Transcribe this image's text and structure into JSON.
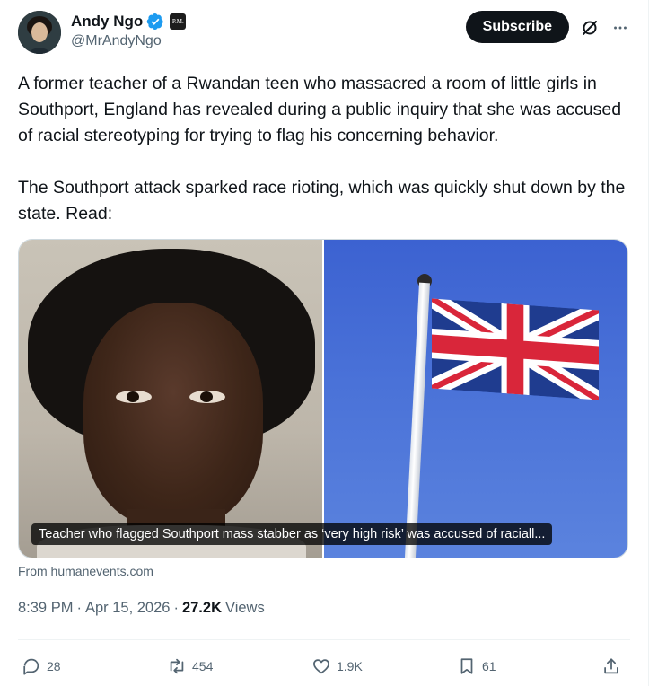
{
  "author": {
    "display_name": "Andy Ngo",
    "handle": "@MrAndyNgo",
    "affiliate_badge_text": "P.M."
  },
  "header": {
    "subscribe_label": "Subscribe"
  },
  "tweet": {
    "text": "A former teacher of a Rwandan teen who massacred a room of little girls in Southport, England has revealed during a public inquiry that she was accused of racial stereotyping for trying to flag his concerning behavior.\n\nThe Southport attack sparked race rioting, which was quickly shut down by the state. Read:",
    "card_caption": "Teacher who flagged Southport mass stabber as ‘very high risk’ was accused of raciall...",
    "card_source": "From humanevents.com"
  },
  "meta": {
    "time": "8:39 PM",
    "dot1": "·",
    "date": "Apr 15, 2026",
    "dot2": "·",
    "views_count": "27.2K",
    "views_label": "Views"
  },
  "actions": {
    "replies": "28",
    "reposts": "454",
    "likes": "1.9K",
    "bookmarks": "61"
  },
  "icons": {
    "verified": "verified-badge-icon",
    "grok": "grok-icon",
    "more": "more-icon",
    "reply": "reply-icon",
    "repost": "repost-icon",
    "like": "heart-icon",
    "bookmark": "bookmark-icon",
    "share": "share-icon"
  },
  "colors": {
    "verified_blue": "#1d9bf0",
    "text_primary": "#0f1419",
    "text_secondary": "#536471",
    "subscribe_bg": "#0f1419"
  }
}
